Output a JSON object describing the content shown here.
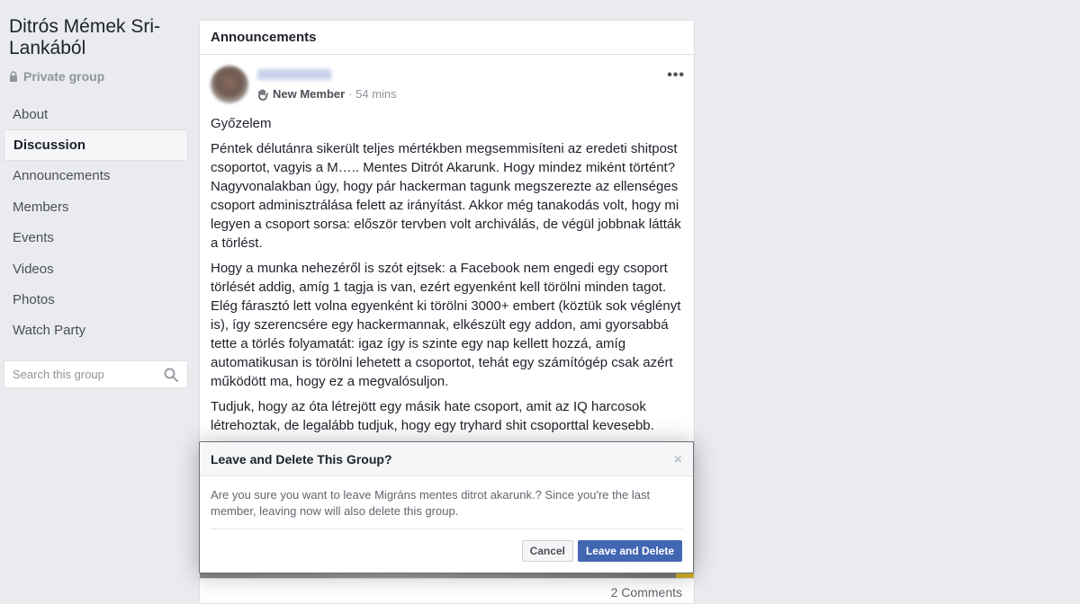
{
  "group": {
    "name": "Ditrós Mémek Sri-Lankából",
    "privacy": "Private group"
  },
  "nav": {
    "items": [
      {
        "label": "About"
      },
      {
        "label": "Discussion"
      },
      {
        "label": "Announcements"
      },
      {
        "label": "Members"
      },
      {
        "label": "Events"
      },
      {
        "label": "Videos"
      },
      {
        "label": "Photos"
      },
      {
        "label": "Watch Party"
      }
    ],
    "active": "Discussion"
  },
  "search": {
    "placeholder": "Search this group"
  },
  "card": {
    "title": "Announcements"
  },
  "post": {
    "badge": "New Member",
    "time": "· 54 mins",
    "more": "•••",
    "paragraphs": [
      "Győzelem",
      "Péntek délutánra sikerült teljes mértékben megsemmisíteni az eredeti shitpost csoportot, vagyis a M….. Mentes Ditrót Akarunk. Hogy mindez miként történt? Nagyvonalakban úgy, hogy pár hackerman tagunk megszerezte az ellenséges csoport adminisztrálása felett az irányítást. Akkor még tanakodás volt, hogy mi legyen a csoport sorsa: először tervben volt archiválás, de végül jobbnak látták a törlést.",
      "Hogy a munka nehezéről is szót ejtsek: a Facebook nem engedi egy csoport törlését addig, amíg 1 tagja is van, ezért egyenként kell törölni minden tagot. Elég fárasztó lett volna egyenként ki törölni 3000+ embert (köztük sok véglényt is), így szerencsére egy hackermannak, elkészült egy addon, ami gyorsabbá tette a törlés folyamatát: igaz így is szinte egy nap kellett hozzá, amíg automatikusan is törölni lehetett a csoportot, tehát egy számítógép csak azért működött ma, hogy ez a megvalósuljon.",
      "Tudjuk, hogy az óta létrejött egy másik hate csoport, amit az IQ harcosok létrehoztak, de legalább tudjuk, hogy egy tryhard shit csoporttal kevesebb."
    ],
    "comments": "2 Comments"
  },
  "modal": {
    "title": "Leave and Delete This Group?",
    "close": "×",
    "body": "Are you sure you want to leave Migráns mentes ditrot akarunk.? Since you're the last member, leaving now will also delete this group.",
    "cancel_label": "Cancel",
    "confirm_label": "Leave and Delete"
  },
  "colors": {
    "background": "#e9ebee",
    "primary_button": "#4267b2",
    "muted_text": "#90949c"
  }
}
